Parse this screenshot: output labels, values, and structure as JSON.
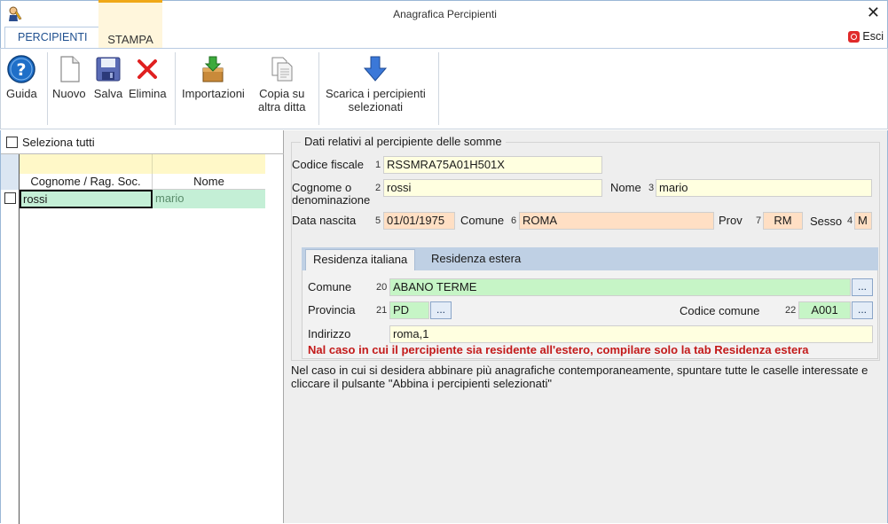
{
  "window": {
    "title": "Anagrafica Percipienti",
    "close_glyph": "✕"
  },
  "ribbon": {
    "tabs": [
      {
        "label": "PERCIPIENTI"
      },
      {
        "label": "STAMPA"
      }
    ],
    "exit_label": "Esci",
    "accent_color": "#f0a818"
  },
  "toolbar": {
    "guida": "Guida",
    "nuovo": "Nuovo",
    "salva": "Salva",
    "elimina": "Elimina",
    "importazioni": "Importazioni",
    "copia_l1": "Copia su",
    "copia_l2": "altra ditta",
    "scarica_l1": "Scarica i percipienti",
    "scarica_l2": "selezionati"
  },
  "list": {
    "select_all_label": "Seleziona tutti",
    "columns": [
      "Cognome / Rag. Soc.",
      "Nome"
    ],
    "rows": [
      {
        "cognome": "rossi",
        "nome": "mario"
      }
    ]
  },
  "form": {
    "group_title": "Dati relativi al percipiente delle somme",
    "codice_fiscale": {
      "label": "Codice fiscale",
      "num": "1",
      "value": "RSSMRA75A01H501X"
    },
    "cognome": {
      "label_l1": "Cognome o",
      "label_l2": "denominazione",
      "num": "2",
      "value": "rossi"
    },
    "nome": {
      "label": "Nome",
      "num": "3",
      "value": "mario"
    },
    "data_nascita": {
      "label": "Data nascita",
      "num": "5",
      "value": "01/01/1975"
    },
    "comune_nascita": {
      "label": "Comune",
      "num": "6",
      "value": "ROMA"
    },
    "prov": {
      "label": "Prov",
      "num": "7",
      "value": "RM"
    },
    "sesso": {
      "label": "Sesso",
      "num": "4",
      "value": "M"
    },
    "subtabs": [
      {
        "label": "Residenza italiana"
      },
      {
        "label": "Residenza estera"
      }
    ],
    "residenza": {
      "comune": {
        "label": "Comune",
        "num": "20",
        "value": "ABANO TERME"
      },
      "provincia": {
        "label": "Provincia",
        "num": "21",
        "value": "PD"
      },
      "codice_comune": {
        "label": "Codice comune",
        "num": "22",
        "value": "A001"
      },
      "indirizzo": {
        "label": "Indirizzo",
        "value": "roma,1"
      },
      "ellipsis": "..."
    },
    "warning": "Nal caso in cui il percipiente sia residente all'estero, compilare solo la tab Residenza estera",
    "note": "Nel caso in cui si desidera abbinare più anagrafiche contemporaneamente, spuntare tutte le caselle interessate e cliccare il pulsante \"Abbina i percipienti selezionati\""
  }
}
